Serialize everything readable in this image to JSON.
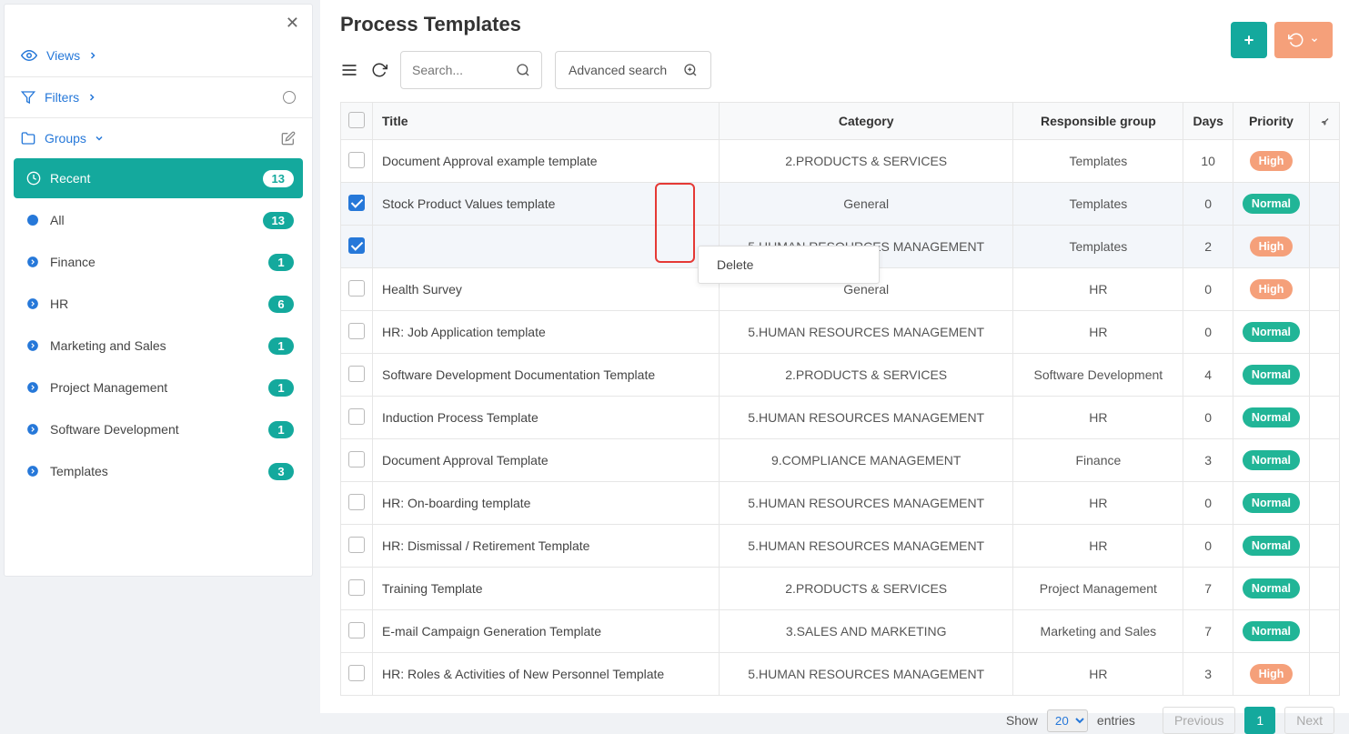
{
  "page": {
    "title": "Process Templates"
  },
  "sidebar": {
    "views_label": "Views",
    "filters_label": "Filters",
    "groups_label": "Groups",
    "items": [
      {
        "label": "Recent",
        "count": "13",
        "active": true,
        "icon": "clock"
      },
      {
        "label": "All",
        "count": "13",
        "active": false,
        "icon": "circle"
      },
      {
        "label": "Finance",
        "count": "1",
        "active": false,
        "icon": "arrow"
      },
      {
        "label": "HR",
        "count": "6",
        "active": false,
        "icon": "arrow"
      },
      {
        "label": "Marketing and Sales",
        "count": "1",
        "active": false,
        "icon": "arrow"
      },
      {
        "label": "Project Management",
        "count": "1",
        "active": false,
        "icon": "arrow"
      },
      {
        "label": "Software Development",
        "count": "1",
        "active": false,
        "icon": "arrow"
      },
      {
        "label": "Templates",
        "count": "3",
        "active": false,
        "icon": "arrow"
      }
    ]
  },
  "toolbar": {
    "search_placeholder": "Search...",
    "advanced_search_label": "Advanced search"
  },
  "context_menu": {
    "delete_label": "Delete"
  },
  "table": {
    "columns": {
      "title": "Title",
      "category": "Category",
      "group": "Responsible group",
      "days": "Days",
      "priority": "Priority"
    },
    "rows": [
      {
        "checked": false,
        "title": "Document Approval example template",
        "category": "2.PRODUCTS & SERVICES",
        "group": "Templates",
        "days": "10",
        "priority": "High"
      },
      {
        "checked": true,
        "title": "Stock Product Values template",
        "category": "General",
        "group": "Templates",
        "days": "0",
        "priority": "Normal"
      },
      {
        "checked": true,
        "title": "",
        "category": "5.HUMAN RESOURCES MANAGEMENT",
        "group": "Templates",
        "days": "2",
        "priority": "High"
      },
      {
        "checked": false,
        "title": "Health Survey",
        "category": "General",
        "group": "HR",
        "days": "0",
        "priority": "High"
      },
      {
        "checked": false,
        "title": "HR: Job Application template",
        "category": "5.HUMAN RESOURCES MANAGEMENT",
        "group": "HR",
        "days": "0",
        "priority": "Normal"
      },
      {
        "checked": false,
        "title": "Software Development Documentation Template",
        "category": "2.PRODUCTS & SERVICES",
        "group": "Software Development",
        "days": "4",
        "priority": "Normal"
      },
      {
        "checked": false,
        "title": "Induction Process Template",
        "category": "5.HUMAN RESOURCES MANAGEMENT",
        "group": "HR",
        "days": "0",
        "priority": "Normal"
      },
      {
        "checked": false,
        "title": "Document Approval Template",
        "category": "9.COMPLIANCE MANAGEMENT",
        "group": "Finance",
        "days": "3",
        "priority": "Normal"
      },
      {
        "checked": false,
        "title": "HR: On-boarding template",
        "category": "5.HUMAN RESOURCES MANAGEMENT",
        "group": "HR",
        "days": "0",
        "priority": "Normal"
      },
      {
        "checked": false,
        "title": "HR: Dismissal / Retirement Template",
        "category": "5.HUMAN RESOURCES MANAGEMENT",
        "group": "HR",
        "days": "0",
        "priority": "Normal"
      },
      {
        "checked": false,
        "title": "Training Template",
        "category": "2.PRODUCTS & SERVICES",
        "group": "Project Management",
        "days": "7",
        "priority": "Normal"
      },
      {
        "checked": false,
        "title": "E-mail Campaign Generation Template",
        "category": "3.SALES AND MARKETING",
        "group": "Marketing and Sales",
        "days": "7",
        "priority": "Normal"
      },
      {
        "checked": false,
        "title": "HR: Roles & Activities of New Personnel Template",
        "category": "5.HUMAN RESOURCES MANAGEMENT",
        "group": "HR",
        "days": "3",
        "priority": "High"
      }
    ]
  },
  "pager": {
    "show_label": "Show",
    "page_size": "20",
    "entries_label": "entries",
    "previous_label": "Previous",
    "page_number": "1",
    "next_label": "Next"
  }
}
